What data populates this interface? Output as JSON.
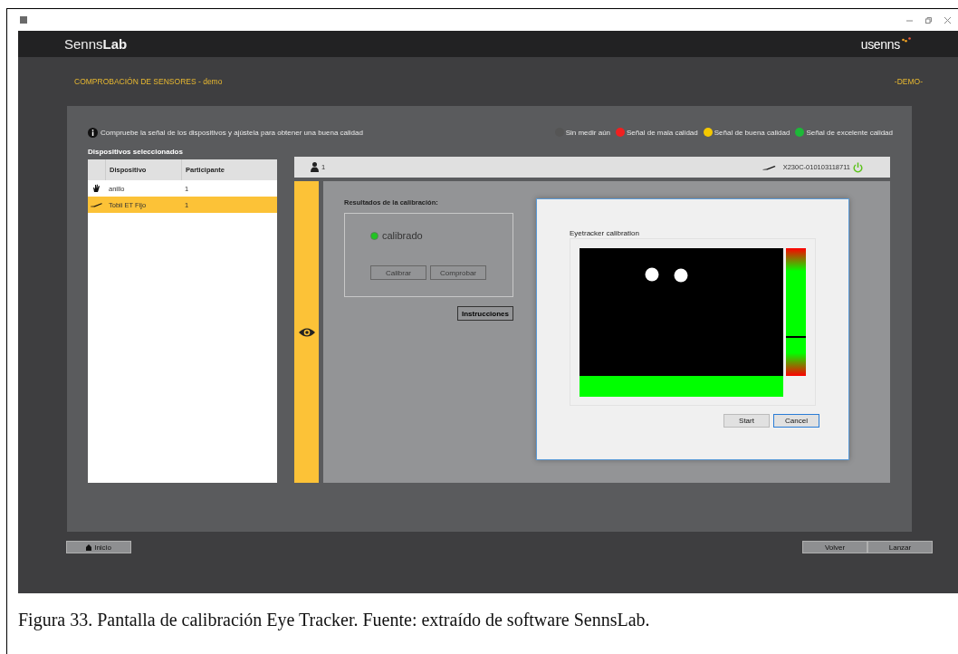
{
  "header": {
    "app_name": "Senns**Lab**",
    "logo": "usenns"
  },
  "page": {
    "title": "COMPROBACIÓN DE SENSORES - demo",
    "mode": "-DEMO-"
  },
  "info": "Compruebe la señal de los dispositivos y ajústela para obtener una buena calidad",
  "legend": [
    {
      "label": "Sin medir aún",
      "color": "#555555"
    },
    {
      "label": "Señal de mala calidad",
      "color": "#f02020"
    },
    {
      "label": "Señal de buena calidad",
      "color": "#f5c800"
    },
    {
      "label": "Señal de excelente calidad",
      "color": "#1db838"
    }
  ],
  "devices": {
    "title": "Dispositivos seleccionados",
    "columns": [
      "Dispositivo",
      "Participante"
    ],
    "rows": [
      {
        "kind": "hand",
        "device": "anillo",
        "participant": "1",
        "selected": false
      },
      {
        "kind": "tracker",
        "device": "Tobii ET Fijo",
        "participant": "1",
        "selected": true
      }
    ]
  },
  "device_panel": {
    "participant": "1",
    "serial": "X230C-010103118711",
    "on": true,
    "calibration": {
      "label": "Resultados de la calibración:",
      "status": "calibrado",
      "buttons": [
        {
          "label": "Calibrar",
          "disabled": true
        },
        {
          "label": "Comprobar",
          "disabled": true
        }
      ],
      "instructions": "Instrucciones"
    }
  },
  "dialog": {
    "title": "Eyetracker calibration",
    "level": 0.3,
    "buttons": [
      {
        "label": "Start",
        "focused": false
      },
      {
        "label": "Cancel",
        "focused": true
      }
    ]
  },
  "footer": {
    "home": "Inicio",
    "buttons": [
      "Volver",
      "Lanzar"
    ]
  },
  "caption": "Figura 33. Pantalla de calibración Eye Tracker. Fuente: extraído de software SennsLab."
}
